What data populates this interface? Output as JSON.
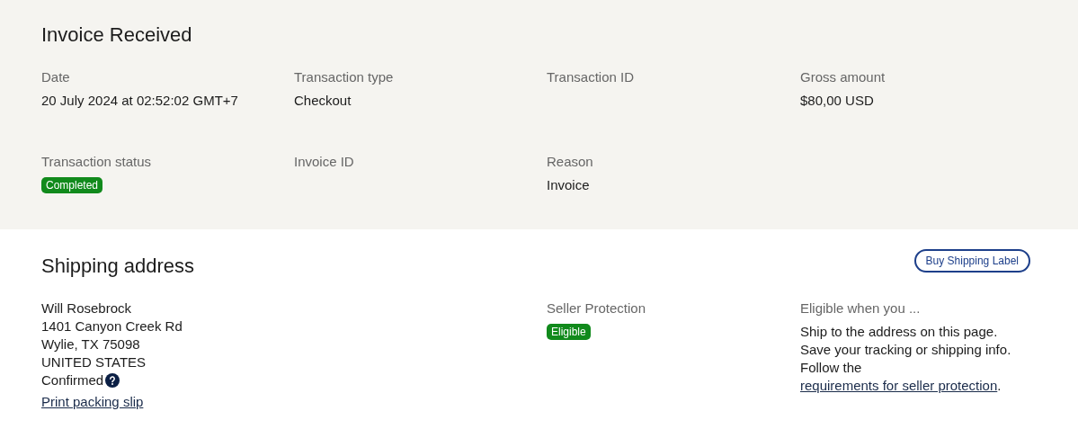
{
  "invoice": {
    "title": "Invoice Received",
    "fields": [
      {
        "label": "Date",
        "kind": "text",
        "value": "20 July 2024 at 02:52:02 GMT+7"
      },
      {
        "label": "Transaction type",
        "kind": "text",
        "value": "Checkout"
      },
      {
        "label": "Transaction ID",
        "kind": "empty"
      },
      {
        "label": "Gross amount",
        "kind": "text",
        "value": "$80,00 USD"
      },
      {
        "label": "Transaction status",
        "kind": "badge",
        "value": "Completed"
      },
      {
        "label": "Invoice ID",
        "kind": "empty"
      },
      {
        "label": "Reason",
        "kind": "text",
        "value": "Invoice"
      }
    ]
  },
  "shipping": {
    "title": "Shipping address",
    "button": "Buy Shipping Label",
    "address_lines": [
      "Will Rosebrock",
      "1401 Canyon Creek Rd",
      "Wylie, TX 75098",
      "UNITED STATES"
    ],
    "status": "Confirmed",
    "print_link": "Print packing slip",
    "protection": {
      "label": "Seller Protection",
      "badge": "Eligible"
    },
    "eligibility": {
      "heading": "Eligible when you ...",
      "lines": [
        "Ship to the address on this page.",
        "Save your tracking or shipping info."
      ],
      "last_line": {
        "before": "Follow the ",
        "link": "requirements for seller protection",
        "after": "."
      }
    }
  }
}
